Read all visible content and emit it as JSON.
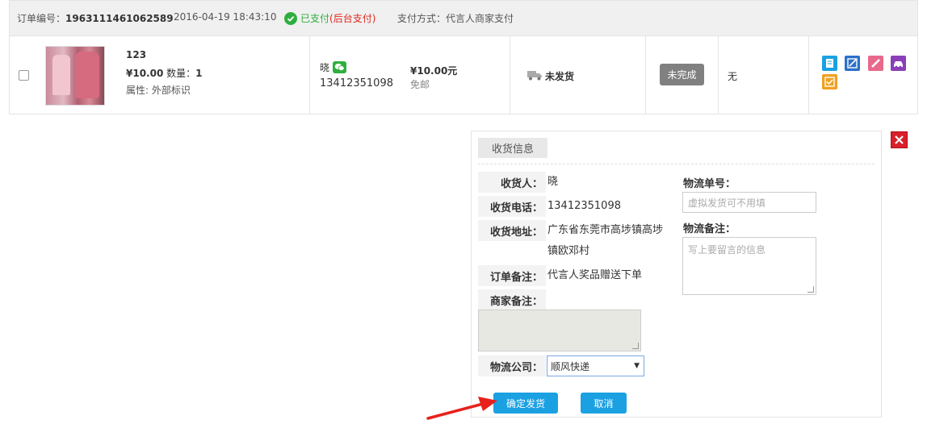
{
  "order": {
    "number_label": "订单编号：",
    "number": "1963111461062589",
    "datetime": "2016-04-19 18:43:10",
    "paid_label": "已支付",
    "paid_note": "(后台支付)",
    "pay_method": "支付方式：代言人商家支付"
  },
  "product": {
    "name": "123",
    "price": "¥10.00",
    "qty_label": "数量：",
    "qty": "1",
    "attr": "属性: 外部标识"
  },
  "buyer": {
    "name": "晓",
    "phone": "13412351098"
  },
  "payment": {
    "amount": "¥10.00元",
    "shipping": "免邮"
  },
  "shipping_status": "未发货",
  "complete_status": "未完成",
  "remark": "无",
  "action_icons": [
    "note-icon",
    "edit-icon",
    "pencil-icon",
    "car-icon",
    "check-note-icon"
  ],
  "popup": {
    "tab": "收货信息",
    "receiver_label": "收货人：",
    "receiver": "晓",
    "phone_label": "收货电话：",
    "phone": "13412351098",
    "address_label": "收货地址：",
    "address": "广东省东莞市高埗镇高埗镇欧邓村",
    "order_note_label": "订单备注：",
    "order_note": "代言人奖品赠送下单",
    "merchant_note_label": "商家备注：",
    "logistics_label": "物流公司：",
    "logistics_selected": "顺风快递",
    "tracking_label": "物流单号：",
    "tracking_placeholder": "虚拟发货可不用填",
    "logistics_remark_label": "物流备注：",
    "logistics_remark_placeholder": "写上要留言的信息",
    "confirm": "确定发货",
    "cancel": "取消"
  },
  "colors": {
    "paid_green": "#2fae3f",
    "accent_blue": "#1ba1e2",
    "close_red": "#d9202a"
  }
}
